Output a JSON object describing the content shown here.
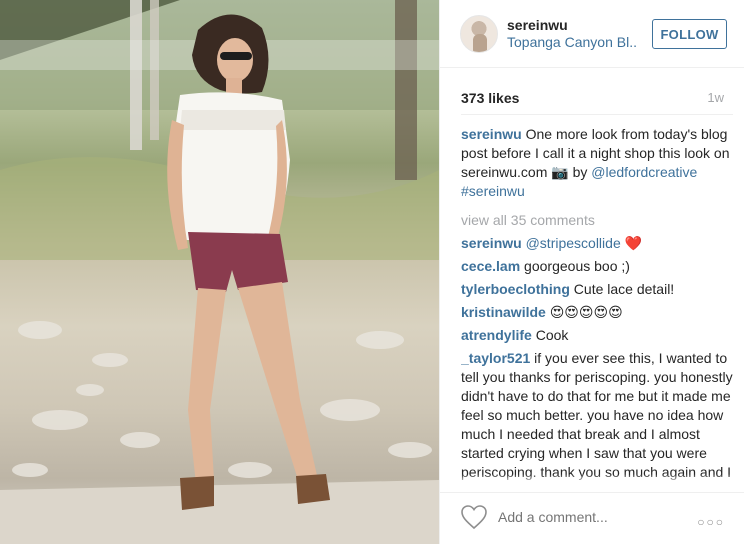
{
  "post": {
    "username": "sereinwu",
    "location": "Topanga Canyon Bl...",
    "follow_label": "FOLLOW",
    "likes": "373 likes",
    "age": "1w"
  },
  "caption": {
    "username": "sereinwu",
    "text_1": " One more look from today's blog post before I call it a night shop this look on sereinwu.com ",
    "camera_emoji": "📷",
    "text_2": " by ",
    "mention": "@ledfordcreative",
    "hashtag": "#sereinwu"
  },
  "view_all_comments": "view all 35 comments",
  "comments": [
    {
      "user": "sereinwu",
      "text": "",
      "mention": "@stripescollide",
      "emoji": "❤️"
    },
    {
      "user": "cece.lam",
      "text": " goorgeous boo ;)"
    },
    {
      "user": "tylerboeclothing",
      "text": " Cute lace detail!"
    },
    {
      "user": "kristinawilde",
      "text": " 😍😍😍😍😍"
    },
    {
      "user": "atrendylife",
      "text": " Cook"
    },
    {
      "user": "_taylor521",
      "text": " if you ever see this, I wanted to tell you thanks for periscoping. you honestly didn't have to do that for me but it made me feel so much better. you have no idea how much I needed that break and I almost started crying when I saw that you were periscoping. thank you so much again and I hope that you have the most amazing weekend because you honestly deserve it!"
    }
  ],
  "comment_input": {
    "placeholder": "Add a comment..."
  },
  "more_options": "○○○",
  "icons": {
    "like": "heart-outline-icon",
    "more": "more-options-icon"
  }
}
